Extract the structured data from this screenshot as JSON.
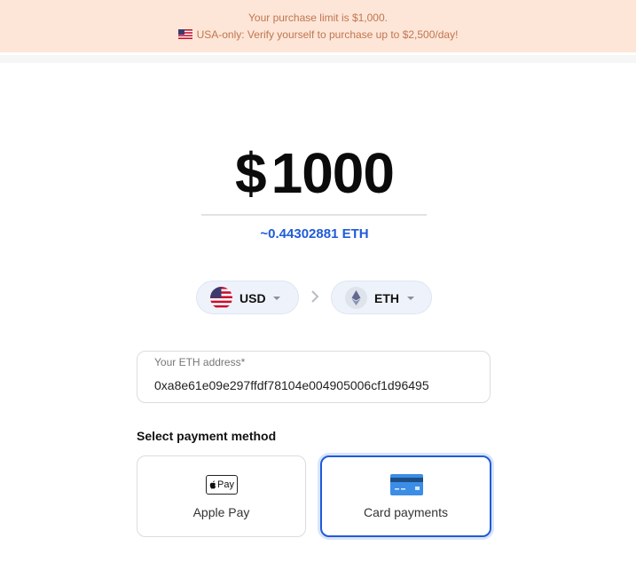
{
  "banner": {
    "line1": "Your purchase limit is $1,000.",
    "line2": "USA-only: Verify yourself to purchase up to $2,500/day!"
  },
  "amount": {
    "currency_symbol": "$",
    "value": "1000",
    "crypto_equivalent": "~0.44302881 ETH"
  },
  "currency_selector": {
    "from": {
      "label": "USD",
      "icon": "us-flag-icon"
    },
    "to": {
      "label": "ETH",
      "icon": "ethereum-icon"
    }
  },
  "address_field": {
    "label": "Your ETH address*",
    "value": "0xa8e61e09e297ffdf78104e004905006cf1d96495"
  },
  "payment": {
    "title": "Select payment method",
    "methods": [
      {
        "label": "Apple Pay",
        "icon": "apple-pay-icon",
        "icon_text": "Pay",
        "selected": false
      },
      {
        "label": "Card payments",
        "icon": "credit-card-icon",
        "selected": true
      }
    ]
  },
  "colors": {
    "accent": "#1f5bd8",
    "banner_bg": "#fde6d8",
    "banner_text": "#c0764f"
  }
}
